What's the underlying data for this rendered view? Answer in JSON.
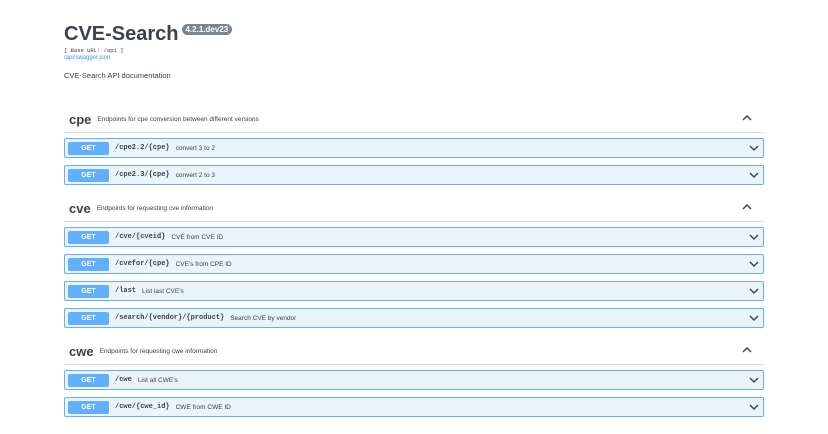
{
  "info": {
    "title": "CVE-Search",
    "version": "4.2.1.dev23",
    "base_url": "[ Base URL: /api ]",
    "swagger_link": "/api/swagger.json",
    "description": "CVE-Search API documentation"
  },
  "icons": {
    "collapse": "chevron-up-icon",
    "expand": "chevron-down-icon"
  },
  "colors": {
    "get_method": "#61affe",
    "get_row_bg": "#ebf3fb",
    "text": "#3b4151",
    "link": "#4990e2",
    "version_badge": "#7d8492"
  },
  "sections": [
    {
      "name": "cpe",
      "description": "Endpoints for cpe conversion between different versions",
      "operations": [
        {
          "method": "GET",
          "path": "/cpe2.2/{cpe}",
          "summary": "convert 3 to 2"
        },
        {
          "method": "GET",
          "path": "/cpe2.3/{cpe}",
          "summary": "convert 2 to 3"
        }
      ]
    },
    {
      "name": "cve",
      "description": "Endpoints for requesting cve information",
      "operations": [
        {
          "method": "GET",
          "path": "/cve/{cveid}",
          "summary": "CVE from CVE ID"
        },
        {
          "method": "GET",
          "path": "/cvefor/{cpe}",
          "summary": "CVE's from CPE ID"
        },
        {
          "method": "GET",
          "path": "/last",
          "summary": "List last CVE's"
        },
        {
          "method": "GET",
          "path": "/search/{vendor}/{product}",
          "summary": "Search CVE by vendor"
        }
      ]
    },
    {
      "name": "cwe",
      "description": "Endpoints for requesting cwe information",
      "operations": [
        {
          "method": "GET",
          "path": "/cwe",
          "summary": "List all CWE's"
        },
        {
          "method": "GET",
          "path": "/cwe/{cwe_id}",
          "summary": "CWE from CWE ID"
        }
      ]
    }
  ]
}
